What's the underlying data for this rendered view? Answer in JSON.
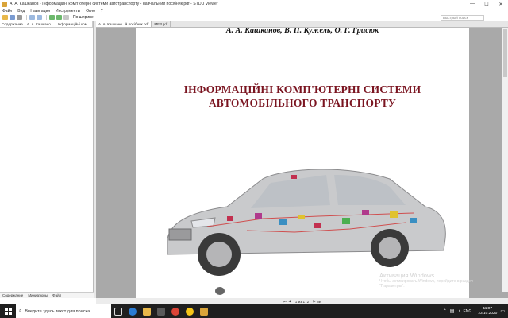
{
  "window": {
    "title": "А. А. Кашканов - Інформаційні комп'ютерні системи автотранспорту - навчальний посібник.pdf - STDU Viewer",
    "controls": [
      "—",
      "☐",
      "✕"
    ]
  },
  "menu": [
    "Файл",
    "Вид",
    "Навигация",
    "Инструменты",
    "Окно",
    "?"
  ],
  "toolbar": {
    "zoom_label": "По ширине",
    "search_placeholder": "Быстрый поиск"
  },
  "sidebar": {
    "tabs": [
      "Содержание",
      "А. А. Кашкано...",
      "Інформаційні ком..."
    ],
    "bottom_tabs": [
      "Содержание",
      "Миниатюры",
      "Файл"
    ]
  },
  "document": {
    "tabs": [
      "А. А. Кашкано...й посібник.pdf",
      "MFP.pdf"
    ],
    "authors": "А. А. Кашканов, В. П. Кужель, О. Г. Грисюк",
    "title_line1": "ІНФОРМАЦІЙНІ КОМП'ЮТЕРНІ СИСТЕМИ",
    "title_line2": "АВТОМОБІЛЬНОГО ТРАНСПОРТУ"
  },
  "status": {
    "page_indicator": "1 из 172"
  },
  "watermark": {
    "line1": "Активация Windows",
    "line2": "Чтобы активировать Windows, перейдите в раздел",
    "line3": "\"Параметры\"."
  },
  "taskbar": {
    "search_placeholder": "Введите здесь текст для поиска",
    "lang": "ENG",
    "time": "11:07",
    "date": "23.10.2020"
  },
  "colors": {
    "title_red": "#7a1420",
    "taskbar": "#1f1f1f"
  }
}
